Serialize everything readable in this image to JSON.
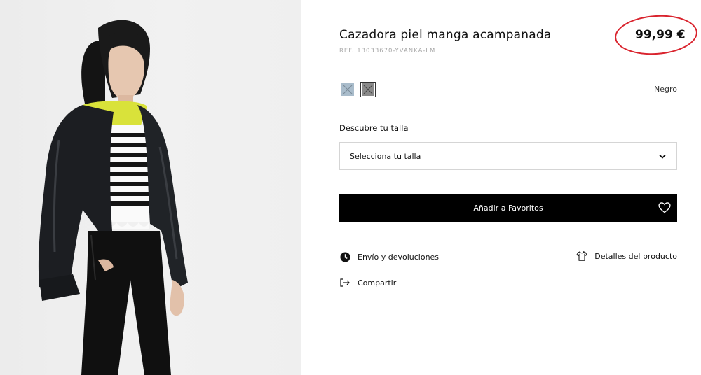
{
  "product": {
    "title": "Cazadora piel manga acampanada",
    "ref": "REF. 13033670-YVANKA-LM",
    "price": "99,99 €",
    "highlight_color": "#d9232d"
  },
  "colors": {
    "selected_name": "Negro",
    "swatches": [
      {
        "name": "blue-gray",
        "color": "#a9bccb",
        "selected": false
      },
      {
        "name": "black",
        "color": "#8a8a8a",
        "selected": true
      }
    ]
  },
  "size": {
    "guide_label": "Descubre tu talla",
    "select_label": "Selecciona tu talla"
  },
  "actions": {
    "favorites_label": "Añadir a Favoritos"
  },
  "links": {
    "shipping": "Envío y devoluciones",
    "details": "Detalles del producto",
    "share": "Compartir"
  },
  "icons": {
    "shipping": "clock-icon",
    "details": "tshirt-icon",
    "share": "share-icon",
    "favorite": "heart-icon",
    "dropdown": "chevron-down-icon"
  }
}
